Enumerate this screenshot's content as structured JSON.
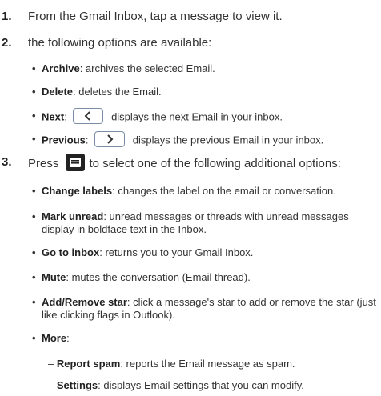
{
  "steps": [
    {
      "num": "1.",
      "text": "From the Gmail Inbox, tap a message to view it."
    },
    {
      "num": "2.",
      "text": "the following options are available:"
    },
    {
      "num": "3.",
      "text_before": "Press",
      "text_after": "to select one of the following additional options:"
    }
  ],
  "bullet": "•",
  "dash": "–",
  "step2_items": [
    {
      "term": "Archive",
      "desc": ": archives the selected Email."
    },
    {
      "term": "Delete",
      "desc": ": deletes the Email."
    },
    {
      "term": "Next",
      "desc": ":",
      "desc_after": "displays the next Email in your inbox.",
      "icon": "chevron-left-icon"
    },
    {
      "term": "Previous",
      "desc": ":",
      "desc_after": "displays the previous Email in your inbox.",
      "icon": "chevron-right-icon"
    }
  ],
  "step3_items": [
    {
      "term": "Change labels",
      "desc": ": changes the label on the email or conversation."
    },
    {
      "term": "Mark unread",
      "desc": ": unread messages or threads with unread messages display in boldface text in the Inbox."
    },
    {
      "term": "Go to inbox",
      "desc": ": returns you to your Gmail Inbox."
    },
    {
      "term": "Mute",
      "desc": ": mutes the conversation (Email thread)."
    },
    {
      "term": "Add/Remove star",
      "desc": ": click a message's star to add or remove the star (just like clicking flags in Outlook)."
    },
    {
      "term": "More",
      "desc": ":"
    }
  ],
  "more_items": [
    {
      "term": "Report spam",
      "desc": ": reports the Email message as spam."
    },
    {
      "term": "Settings",
      "desc": ": displays Email settings that you can modify."
    }
  ],
  "icons": {
    "menu_key": "menu-key-icon",
    "next": "chevron-left-icon",
    "previous": "chevron-right-icon"
  },
  "colors": {
    "text": "#333333",
    "heading": "#222222",
    "key_border": "#7a8fa6",
    "menu_key_bg": "#222222"
  }
}
